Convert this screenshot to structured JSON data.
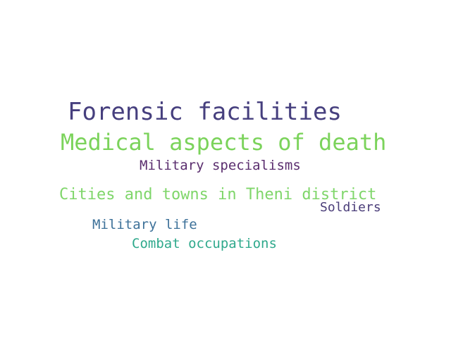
{
  "words": [
    {
      "text": "Forensic facilities",
      "color": "#463f7e"
    },
    {
      "text": "Medical aspects of death",
      "color": "#7bd35b"
    },
    {
      "text": "Military specialisms",
      "color": "#5a2d6e"
    },
    {
      "text": "Cities and towns in Theni district",
      "color": "#7fd66a"
    },
    {
      "text": "Soldiers",
      "color": "#4a3d79"
    },
    {
      "text": "Military life",
      "color": "#3d7199"
    },
    {
      "text": "Combat occupations",
      "color": "#2fa98c"
    }
  ]
}
